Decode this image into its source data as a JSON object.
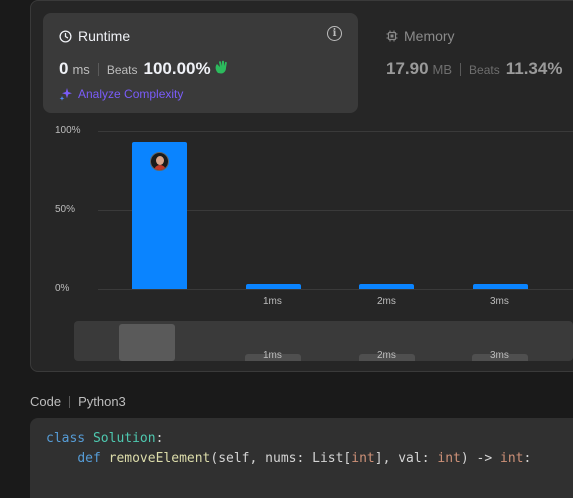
{
  "runtime": {
    "title": "Runtime",
    "value": "0",
    "unit": "ms",
    "beats_label": "Beats",
    "beats_value": "100.00%",
    "analyze_label": "Analyze Complexity"
  },
  "memory": {
    "title": "Memory",
    "value": "17.90",
    "unit": "MB",
    "beats_label": "Beats",
    "beats_value": "11.34%"
  },
  "chart_data": {
    "type": "bar",
    "y_ticks": [
      "100%",
      "50%",
      "0%"
    ],
    "categories": [
      "",
      "1ms",
      "2ms",
      "3ms"
    ],
    "values": [
      93,
      3,
      3,
      3
    ],
    "ylim": [
      0,
      100
    ],
    "grid": true,
    "bar_color": "#0a84ff",
    "highlighted_category_index": 0
  },
  "scrubber": {
    "labels": [
      "1ms",
      "2ms",
      "3ms"
    ]
  },
  "code": {
    "header_label": "Code",
    "language": "Python3",
    "lines": [
      [
        {
          "t": "class ",
          "c": "kw"
        },
        {
          "t": "Solution",
          "c": "cls"
        },
        {
          "t": ":",
          "c": "txt"
        }
      ],
      [
        {
          "t": "    ",
          "c": "txt"
        },
        {
          "t": "def ",
          "c": "kw"
        },
        {
          "t": "removeElement",
          "c": "fn"
        },
        {
          "t": "(self, nums: List[",
          "c": "txt"
        },
        {
          "t": "int",
          "c": "ty"
        },
        {
          "t": "], val: ",
          "c": "txt"
        },
        {
          "t": "int",
          "c": "ty"
        },
        {
          "t": ") -> ",
          "c": "txt"
        },
        {
          "t": "int",
          "c": "ty"
        },
        {
          "t": ":",
          "c": "txt"
        }
      ]
    ]
  },
  "colors": {
    "accent": "#0a84ff",
    "analyze": "#7a5cfa",
    "clap": "#2cbb5d"
  }
}
